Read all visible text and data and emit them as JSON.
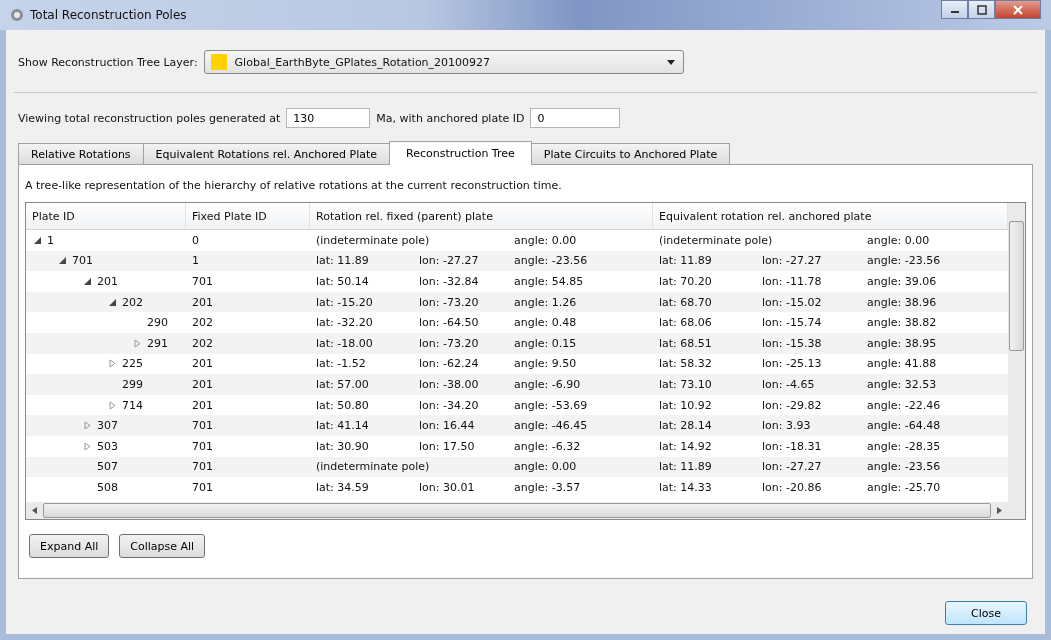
{
  "window": {
    "title": "Total Reconstruction Poles"
  },
  "layer": {
    "label": "Show Reconstruction Tree Layer:",
    "value": "Global_EarthByte_GPlates_Rotation_20100927",
    "color": "#ffd200"
  },
  "viewing": {
    "label_before": "Viewing total reconstruction poles generated at",
    "time": "130",
    "label_after": "Ma, with anchored plate ID",
    "anchored_plate": "0"
  },
  "tabs": [
    {
      "label": "Relative Rotations",
      "selected": false
    },
    {
      "label": "Equivalent Rotations rel. Anchored Plate",
      "selected": false
    },
    {
      "label": "Reconstruction Tree",
      "selected": true
    },
    {
      "label": "Plate Circuits to Anchored Plate",
      "selected": false
    }
  ],
  "description": "A tree-like representation of the hierarchy of relative rotations at the current reconstruction time.",
  "table": {
    "columns": [
      "Plate ID",
      "Fixed Plate ID",
      "Rotation rel. fixed (parent) plate",
      "Equivalent rotation rel. anchored plate"
    ],
    "rows": [
      {
        "plate_id": "1",
        "fixed_plate_id": "0",
        "expanded": true,
        "relative": [
          "(indeterminate pole)",
          "angle: 0.00"
        ],
        "equivalent": [
          "(indeterminate pole)",
          "angle: 0.00"
        ],
        "children": [
          {
            "plate_id": "701",
            "fixed_plate_id": "1",
            "expanded": true,
            "relative": [
              "lat: 11.89",
              "lon: -27.27",
              "angle: -23.56"
            ],
            "equivalent": [
              "lat: 11.89",
              "lon: -27.27",
              "angle: -23.56"
            ],
            "children": [
              {
                "plate_id": "201",
                "fixed_plate_id": "701",
                "expanded": true,
                "relative": [
                  "lat: 50.14",
                  "lon: -32.84",
                  "angle: 54.85"
                ],
                "equivalent": [
                  "lat: 70.20",
                  "lon: -11.78",
                  "angle: 39.06"
                ],
                "children": [
                  {
                    "plate_id": "202",
                    "fixed_plate_id": "201",
                    "expanded": true,
                    "relative": [
                      "lat: -15.20",
                      "lon: -73.20",
                      "angle: 1.26"
                    ],
                    "equivalent": [
                      "lat: 68.70",
                      "lon: -15.02",
                      "angle: 38.96"
                    ],
                    "children": [
                      {
                        "plate_id": "290",
                        "fixed_plate_id": "202",
                        "relative": [
                          "lat: -32.20",
                          "lon: -64.50",
                          "angle: 0.48"
                        ],
                        "equivalent": [
                          "lat: 68.06",
                          "lon: -15.74",
                          "angle: 38.82"
                        ]
                      },
                      {
                        "plate_id": "291",
                        "fixed_plate_id": "202",
                        "expanded": false,
                        "relative": [
                          "lat: -18.00",
                          "lon: -73.20",
                          "angle: 0.15"
                        ],
                        "equivalent": [
                          "lat: 68.51",
                          "lon: -15.38",
                          "angle: 38.95"
                        ]
                      }
                    ]
                  },
                  {
                    "plate_id": "225",
                    "fixed_plate_id": "201",
                    "expanded": false,
                    "relative": [
                      "lat: -1.52",
                      "lon: -62.24",
                      "angle: 9.50"
                    ],
                    "equivalent": [
                      "lat: 58.32",
                      "lon: -25.13",
                      "angle: 41.88"
                    ]
                  },
                  {
                    "plate_id": "299",
                    "fixed_plate_id": "201",
                    "relative": [
                      "lat: 57.00",
                      "lon: -38.00",
                      "angle: -6.90"
                    ],
                    "equivalent": [
                      "lat: 73.10",
                      "lon: -4.65",
                      "angle: 32.53"
                    ]
                  },
                  {
                    "plate_id": "714",
                    "fixed_plate_id": "201",
                    "expanded": false,
                    "relative": [
                      "lat: 50.80",
                      "lon: -34.20",
                      "angle: -53.69"
                    ],
                    "equivalent": [
                      "lat: 10.92",
                      "lon: -29.82",
                      "angle: -22.46"
                    ]
                  }
                ]
              },
              {
                "plate_id": "307",
                "fixed_plate_id": "701",
                "expanded": false,
                "relative": [
                  "lat: 41.14",
                  "lon: 16.44",
                  "angle: -46.45"
                ],
                "equivalent": [
                  "lat: 28.14",
                  "lon: 3.93",
                  "angle: -64.48"
                ]
              },
              {
                "plate_id": "503",
                "fixed_plate_id": "701",
                "expanded": false,
                "relative": [
                  "lat: 30.90",
                  "lon: 17.50",
                  "angle: -6.32"
                ],
                "equivalent": [
                  "lat: 14.92",
                  "lon: -18.31",
                  "angle: -28.35"
                ]
              },
              {
                "plate_id": "507",
                "fixed_plate_id": "701",
                "relative": [
                  "(indeterminate pole)",
                  "angle: 0.00"
                ],
                "equivalent": [
                  "lat: 11.89",
                  "lon: -27.27",
                  "angle: -23.56"
                ]
              },
              {
                "plate_id": "508",
                "fixed_plate_id": "701",
                "relative": [
                  "lat: 34.59",
                  "lon: 30.01",
                  "angle: -3.57"
                ],
                "equivalent": [
                  "lat: 14.33",
                  "lon: -20.86",
                  "angle: -25.70"
                ]
              }
            ]
          }
        ]
      }
    ]
  },
  "buttons": [
    {
      "label": "Expand All"
    },
    {
      "label": "Collapse All"
    }
  ],
  "close_button": {
    "label": "Close"
  }
}
